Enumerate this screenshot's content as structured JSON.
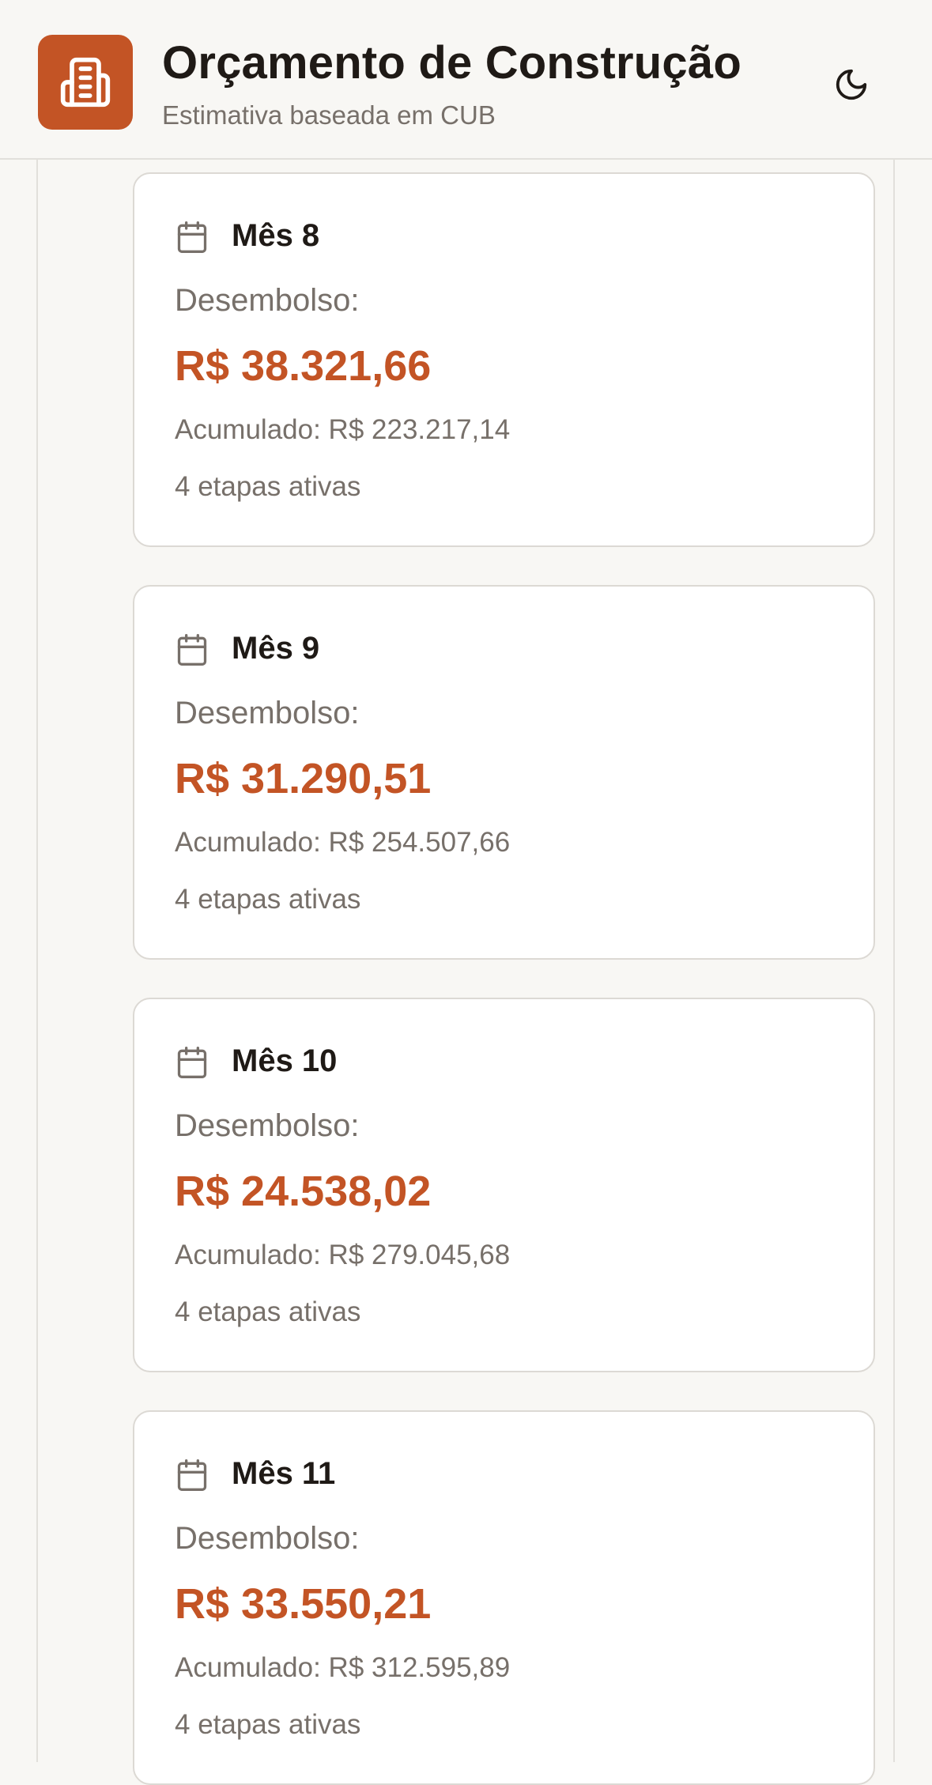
{
  "header": {
    "title": "Orçamento de Construção",
    "subtitle": "Estimativa baseada em CUB",
    "logo_icon": "building-icon",
    "theme_icon": "moon-icon",
    "accent_color": "#c35425"
  },
  "months": [
    {
      "label": "Mês 8",
      "disbursement_label": "Desembolso:",
      "disbursement_value": "R$ 38.321,66",
      "accumulated": "Acumulado: R$ 223.217,14",
      "stages": "4 etapas ativas"
    },
    {
      "label": "Mês 9",
      "disbursement_label": "Desembolso:",
      "disbursement_value": "R$ 31.290,51",
      "accumulated": "Acumulado: R$ 254.507,66",
      "stages": "4 etapas ativas"
    },
    {
      "label": "Mês 10",
      "disbursement_label": "Desembolso:",
      "disbursement_value": "R$ 24.538,02",
      "accumulated": "Acumulado: R$ 279.045,68",
      "stages": "4 etapas ativas"
    },
    {
      "label": "Mês 11",
      "disbursement_label": "Desembolso:",
      "disbursement_value": "R$ 33.550,21",
      "accumulated": "Acumulado: R$ 312.595,89",
      "stages": "4 etapas ativas"
    }
  ]
}
